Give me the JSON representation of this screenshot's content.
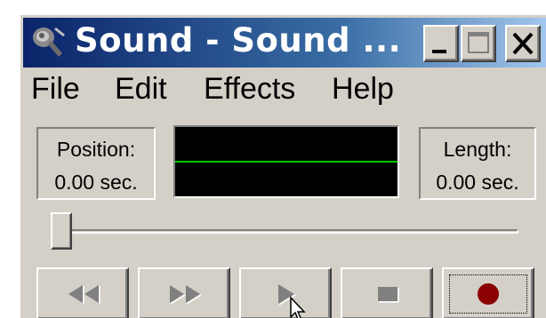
{
  "window": {
    "title": "Sound - Sound ...",
    "icons": {
      "app": "speaker-icon",
      "minimize": "minimize-icon",
      "maximize": "maximize-icon",
      "close": "close-icon"
    }
  },
  "menu": {
    "items": [
      {
        "label": "File"
      },
      {
        "label": "Edit"
      },
      {
        "label": "Effects"
      },
      {
        "label": "Help"
      }
    ]
  },
  "position": {
    "label": "Position:",
    "value": "0.00 sec."
  },
  "length": {
    "label": "Length:",
    "value": "0.00 sec."
  },
  "waveform": {
    "background": "#000000",
    "line_color": "#00c800"
  },
  "seek": {
    "fraction": 0.0
  },
  "controls": {
    "buttons": [
      {
        "name": "seek-to-start-button",
        "icon": "rewind-icon"
      },
      {
        "name": "seek-to-end-button",
        "icon": "fast-forward-icon"
      },
      {
        "name": "play-button",
        "icon": "play-icon"
      },
      {
        "name": "stop-button",
        "icon": "stop-icon"
      },
      {
        "name": "record-button",
        "icon": "record-icon",
        "color": "#8b0000"
      }
    ]
  },
  "colors": {
    "face": "#d4d0c8",
    "title_start": "#0a246a",
    "title_end": "#a6caf0",
    "disabled_glyph": "#808080"
  }
}
